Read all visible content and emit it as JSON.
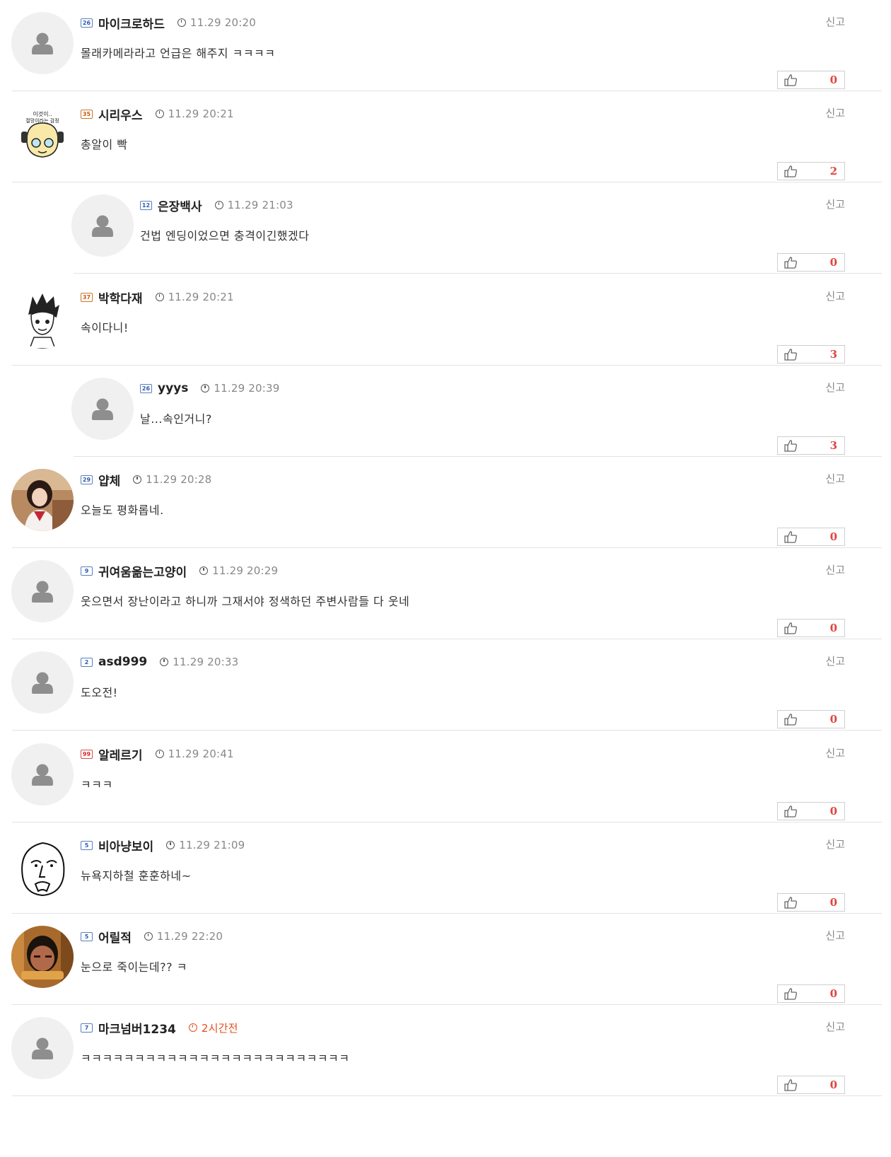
{
  "report_label": "신고",
  "icons": {
    "thumb": "thumbs-up-icon",
    "clock": "clock-icon",
    "avatar": "default-avatar-icon"
  },
  "colors": {
    "like_count": "#e0443e",
    "recent_time": "#e2501e",
    "level_badge": "#2b5cb0"
  },
  "comments": [
    {
      "level": "26",
      "level_color": "blue",
      "nickname": "마이크로하드",
      "time": "11.29 20:20",
      "text": "몰래카메라라고 언급은 해주지 ㅋㅋㅋㅋ",
      "likes": "0",
      "reply": false,
      "avatar": "default"
    },
    {
      "level": "35",
      "level_color": "orange",
      "nickname": "시리우스",
      "time": "11.29 20:21",
      "text": "총알이 빡",
      "likes": "2",
      "reply": false,
      "avatar": "cartoon-girl",
      "avatar_caption": "이것이.. 절망이라는 감정"
    },
    {
      "level": "12",
      "level_color": "blue",
      "nickname": "은장백사",
      "time": "11.29 21:03",
      "text": "건법 엔딩이었으면 충격이긴했겠다",
      "likes": "0",
      "reply": true,
      "avatar": "default"
    },
    {
      "level": "37",
      "level_color": "orange",
      "nickname": "박학다재",
      "time": "11.29 20:21",
      "text": "속이다니!",
      "likes": "3",
      "reply": false,
      "avatar": "manga-boy"
    },
    {
      "level": "26",
      "level_color": "blue",
      "nickname": "yyys",
      "time": "11.29 20:39",
      "text": "날...속인거니?",
      "likes": "3",
      "reply": true,
      "avatar": "default"
    },
    {
      "level": "29",
      "level_color": "blue",
      "nickname": "얍체",
      "time": "11.29 20:28",
      "text": "오늘도 평화롭네.",
      "likes": "0",
      "reply": false,
      "avatar": "photo-girl"
    },
    {
      "level": "9",
      "level_color": "blue",
      "nickname": "귀여움옮는고양이",
      "time": "11.29 20:29",
      "text": "웃으면서 장난이라고 하니까 그재서야 정색하던 주변사람들 다 웃네",
      "likes": "0",
      "reply": false,
      "avatar": "default"
    },
    {
      "level": "2",
      "level_color": "blue",
      "nickname": "asd999",
      "time": "11.29 20:33",
      "text": "도오전!",
      "likes": "0",
      "reply": false,
      "avatar": "default"
    },
    {
      "level": "99",
      "level_color": "red",
      "nickname": "알레르기",
      "time": "11.29 20:41",
      "text": "ㅋㅋㅋ",
      "likes": "0",
      "reply": false,
      "avatar": "default"
    },
    {
      "level": "5",
      "level_color": "blue",
      "nickname": "비아냥보이",
      "time": "11.29 21:09",
      "text": "뉴욕지하철 훈훈하네~",
      "likes": "0",
      "reply": false,
      "avatar": "meme-face"
    },
    {
      "level": "5",
      "level_color": "blue",
      "nickname": "어릴적",
      "time": "11.29 22:20",
      "text": "눈으로 죽이는데?? ㅋ",
      "likes": "0",
      "reply": false,
      "avatar": "photo-man"
    },
    {
      "level": "7",
      "level_color": "blue",
      "nickname": "마크넘버1234",
      "time": "2시간전",
      "time_recent": true,
      "text": "ㅋㅋㅋㅋㅋㅋㅋㅋㅋㅋㅋㅋㅋㅋㅋㅋㅋㅋㅋㅋㅋㅋㅋㅋㅋ",
      "likes": "0",
      "reply": false,
      "avatar": "default"
    }
  ]
}
